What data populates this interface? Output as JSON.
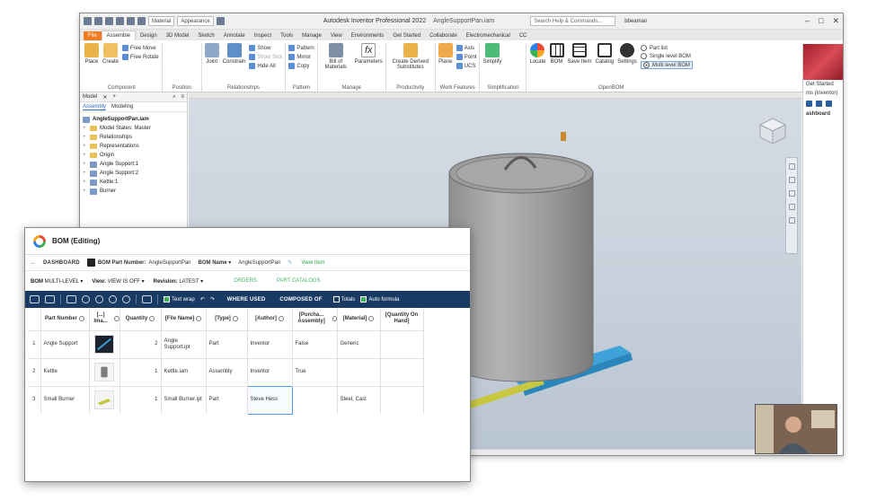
{
  "inventor": {
    "title_app": "Autodesk Inventor Professional 2022",
    "title_doc": "AngleSupportPan.iam",
    "file_dropdown": "Material",
    "appearance_dropdown": "Appearance",
    "help_placeholder": "Search Help & Commands...",
    "user": "bbeaman",
    "tabs": [
      "File",
      "Assemble",
      "Design",
      "3D Model",
      "Sketch",
      "Annotate",
      "Inspect",
      "Tools",
      "Manage",
      "View",
      "Environments",
      "Get Started",
      "Collaborate",
      "Electromechanical",
      "CC"
    ],
    "active_tab": "Assemble",
    "ribbon": {
      "component": {
        "label": "Component",
        "place": "Place",
        "create": "Create",
        "free_move": "Free Move",
        "free_rotate": "Free Rotate"
      },
      "position": {
        "label": "Position"
      },
      "relationships": {
        "label": "Relationships",
        "joint": "Joint",
        "constrain": "Constrain",
        "show": "Show",
        "show_sick": "Show Sick",
        "hide_all": "Hide All"
      },
      "pattern": {
        "label": "Pattern",
        "pattern": "Pattern",
        "mirror": "Mirror",
        "copy": "Copy"
      },
      "manage": {
        "label": "Manage",
        "bom": "Bill of Materials",
        "parameters": "Parameters"
      },
      "productivity": {
        "label": "Productivity",
        "create_derived": "Create Derived Substitutes"
      },
      "work_features": {
        "label": "Work Features",
        "plane": "Plane",
        "axis": "Axis",
        "point": "Point",
        "ucs": "UCS"
      },
      "simplification": {
        "label": "Simplification",
        "simplify": "Simplify"
      },
      "openbom": {
        "label": "OpenBOM",
        "locate": "Locate",
        "bom": "BOM",
        "save_item": "Save Item",
        "catalog": "Catalog",
        "settings": "Settings",
        "part_list": "Part list",
        "single_level": "Single level BOM",
        "multi_level": "Multi level BOM"
      }
    },
    "browser": {
      "title": "Model",
      "tabs": [
        "Assembly",
        "Modeling"
      ],
      "tree": [
        {
          "label": "AngleSupportPan.iam",
          "kind": "root"
        },
        {
          "label": "Model States: Master",
          "kind": "folder"
        },
        {
          "label": "Relationships",
          "kind": "folder"
        },
        {
          "label": "Representations",
          "kind": "folder"
        },
        {
          "label": "Origin",
          "kind": "folder"
        },
        {
          "label": "Angle Support:1",
          "kind": "part"
        },
        {
          "label": "Angle Support:2",
          "kind": "part"
        },
        {
          "label": "Kettle:1",
          "kind": "part"
        },
        {
          "label": "Burner",
          "kind": "part"
        }
      ]
    },
    "right_panel": {
      "text1": "Get Started",
      "text2": "ms (Inventor)",
      "text3": "ashboard"
    }
  },
  "bom": {
    "title": "BOM (Editing)",
    "nav": {
      "dashboard": "DASHBOARD",
      "part_number_label": "BOM Part Number:",
      "part_number_value": "AngleSupportPan",
      "bom_name_label": "BOM Name",
      "bom_name_value": "AngleSupportPan",
      "view_item": "View Item"
    },
    "options": {
      "bom_label": "BOM",
      "bom_value": "MULTI-LEVEL",
      "view_label": "View:",
      "view_value": "VIEW IS OFF",
      "revision_label": "Revision:",
      "revision_value": "LATEST",
      "orders": "ORDERS",
      "part_catalogs": "PART CATALOGS"
    },
    "toolbar": {
      "text_wrap": "Text wrap",
      "where_used": "WHERE USED",
      "composed_of": "COMPOSED OF",
      "totals": "Totals",
      "auto_formula": "Auto formula"
    },
    "columns": [
      "",
      "Part Number",
      "[...] Ima...",
      "Quantity",
      "[File Name]",
      "[Type]",
      "[Author]",
      "[Purcha... Assembly]",
      "[Material]",
      "[Quantity On Hand]"
    ],
    "rows": [
      {
        "n": "1",
        "part": "Angle Support",
        "qty": "2",
        "file": "Angle Support.ipt",
        "type": "Part",
        "author": "Inventor",
        "purch": "False",
        "material": "Generic",
        "onhand": ""
      },
      {
        "n": "2",
        "part": "Kettle",
        "qty": "1",
        "file": "Kettle.iam",
        "type": "Assembly",
        "author": "Inventor",
        "purch": "True",
        "material": "",
        "onhand": ""
      },
      {
        "n": "3",
        "part": "Small Burner",
        "qty": "1",
        "file": "Small Burner.ipt",
        "type": "Part",
        "author": "Steve Hess",
        "purch": "",
        "material": "Steel, Cast",
        "onhand": ""
      }
    ]
  },
  "colors": {
    "ribbon_file": "#f37b20",
    "bom_toolbar": "#183a63",
    "openbom_green": "#45b36a",
    "viewport_bg": "#c9d1dc"
  }
}
